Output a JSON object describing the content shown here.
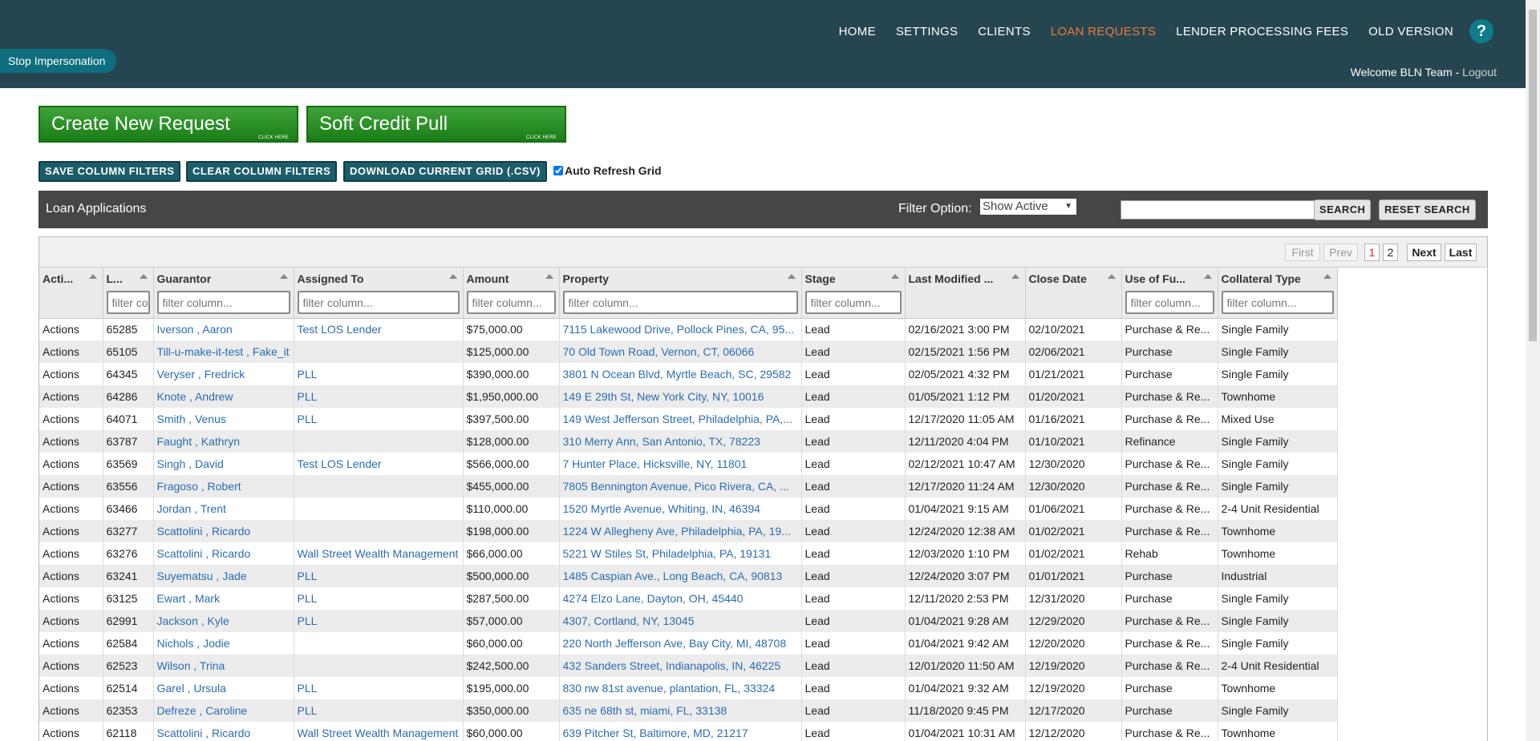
{
  "nav": {
    "items": [
      "HOME",
      "SETTINGS",
      "CLIENTS",
      "LOAN REQUESTS",
      "LENDER PROCESSING FEES",
      "OLD VERSION"
    ],
    "active": "LOAN REQUESTS",
    "help": "?"
  },
  "impersonation": {
    "label": "Stop Impersonation"
  },
  "welcome": {
    "text": "Welcome BLN Team",
    "separator": " - ",
    "logout": "Logout"
  },
  "actions": {
    "create_request": "Create New Request",
    "soft_credit": "Soft Credit Pull",
    "click_here": "CLICK HERE"
  },
  "toolbar": {
    "save_filters": "SAVE COLUMN FILTERS",
    "clear_filters": "CLEAR COLUMN FILTERS",
    "download_csv": "DOWNLOAD CURRENT GRID (.CSV)",
    "auto_refresh": "Auto Refresh Grid",
    "auto_refresh_checked": true
  },
  "panel": {
    "title": "Loan Applications",
    "filter_label": "Filter Option:",
    "filter_value": "Show Active",
    "search_value": "",
    "search_button": "SEARCH",
    "reset_button": "RESET SEARCH"
  },
  "pager": {
    "first": "First",
    "prev": "Prev",
    "pages": [
      "1",
      "2"
    ],
    "current": "1",
    "next": "Next",
    "last": "Last"
  },
  "filter_placeholder": "filter column...",
  "columns": [
    {
      "label": "Acti...",
      "filter": false
    },
    {
      "label": "L...",
      "filter": true
    },
    {
      "label": "Guarantor",
      "filter": true
    },
    {
      "label": "Assigned To",
      "filter": true
    },
    {
      "label": "Amount",
      "filter": true
    },
    {
      "label": "Property",
      "filter": true
    },
    {
      "label": "Stage",
      "filter": true
    },
    {
      "label": "Last Modified ...",
      "filter": false
    },
    {
      "label": "Close Date",
      "filter": false
    },
    {
      "label": "Use of Fu...",
      "filter": true
    },
    {
      "label": "Collateral Type",
      "filter": true
    }
  ],
  "rows": [
    [
      "Actions",
      "65285",
      "Iverson , Aaron",
      "Test LOS Lender",
      "$75,000.00",
      "7115 Lakewood Drive, Pollock Pines, CA, 95...",
      "Lead",
      "02/16/2021 3:00 PM",
      "02/10/2021",
      "Purchase & Re...",
      "Single Family"
    ],
    [
      "Actions",
      "65105",
      "Till-u-make-it-test , Fake_it",
      "",
      "$125,000.00",
      "70 Old Town Road, Vernon, CT, 06066",
      "Lead",
      "02/15/2021 1:56 PM",
      "02/06/2021",
      "Purchase",
      "Single Family"
    ],
    [
      "Actions",
      "64345",
      "Veryser , Fredrick",
      "PLL",
      "$390,000.00",
      "3801 N Ocean Blvd, Myrtle Beach, SC, 29582",
      "Lead",
      "02/05/2021 4:32 PM",
      "01/21/2021",
      "Purchase",
      "Single Family"
    ],
    [
      "Actions",
      "64286",
      "Knote , Andrew",
      "PLL",
      "$1,950,000.00",
      "149 E 29th St, New York City, NY, 10016",
      "Lead",
      "01/05/2021 1:12 PM",
      "01/20/2021",
      "Purchase & Re...",
      "Townhome"
    ],
    [
      "Actions",
      "64071",
      "Smith , Venus",
      "PLL",
      "$397,500.00",
      "149 West Jefferson Street, Philadelphia, PA,...",
      "Lead",
      "12/17/2020 11:05 AM",
      "01/16/2021",
      "Purchase & Re...",
      "Mixed Use"
    ],
    [
      "Actions",
      "63787",
      "Faught , Kathryn",
      "",
      "$128,000.00",
      "310 Merry Ann, San Antonio, TX, 78223",
      "Lead",
      "12/11/2020 4:04 PM",
      "01/10/2021",
      "Refinance",
      "Single Family"
    ],
    [
      "Actions",
      "63569",
      "Singh , David",
      "Test LOS Lender",
      "$566,000.00",
      "7 Hunter Place, Hicksville, NY, 11801",
      "Lead",
      "02/12/2021 10:47 AM",
      "12/30/2020",
      "Purchase & Re...",
      "Single Family"
    ],
    [
      "Actions",
      "63556",
      "Fragoso , Robert",
      "",
      "$455,000.00",
      "7805 Bennington Avenue, Pico Rivera, CA, ...",
      "Lead",
      "12/17/2020 11:24 AM",
      "12/30/2020",
      "Purchase & Re...",
      "Single Family"
    ],
    [
      "Actions",
      "63466",
      "Jordan , Trent",
      "",
      "$110,000.00",
      "1520 Myrtle Avenue, Whiting, IN, 46394",
      "Lead",
      "01/04/2021 9:15 AM",
      "01/06/2021",
      "Purchase & Re...",
      "2-4 Unit Residential"
    ],
    [
      "Actions",
      "63277",
      "Scattolini , Ricardo",
      "",
      "$198,000.00",
      "1224 W Allegheny Ave, Philadelphia, PA, 19...",
      "Lead",
      "12/24/2020 12:38 AM",
      "01/02/2021",
      "Purchase & Re...",
      "Townhome"
    ],
    [
      "Actions",
      "63276",
      "Scattolini , Ricardo",
      "Wall Street Wealth Management",
      "$66,000.00",
      "5221 W Stiles St, Philadelphia, PA, 19131",
      "Lead",
      "12/03/2020 1:10 PM",
      "01/02/2021",
      "Rehab",
      "Townhome"
    ],
    [
      "Actions",
      "63241",
      "Suyematsu , Jade",
      "PLL",
      "$500,000.00",
      "1485 Caspian Ave., Long Beach, CA, 90813",
      "Lead",
      "12/24/2020 3:07 PM",
      "01/01/2021",
      "Purchase",
      "Industrial"
    ],
    [
      "Actions",
      "63125",
      "Ewart , Mark",
      "PLL",
      "$287,500.00",
      "4274 Elzo Lane, Dayton, OH, 45440",
      "Lead",
      "12/11/2020 2:53 PM",
      "12/31/2020",
      "Purchase",
      "Single Family"
    ],
    [
      "Actions",
      "62991",
      "Jackson , Kyle",
      "PLL",
      "$57,000.00",
      "4307, Cortland, NY, 13045",
      "Lead",
      "01/04/2021 9:28 AM",
      "12/29/2020",
      "Purchase & Re...",
      "Single Family"
    ],
    [
      "Actions",
      "62584",
      "Nichols , Jodie",
      "",
      "$60,000.00",
      "220 North Jefferson Ave, Bay City, MI, 48708",
      "Lead",
      "01/04/2021 9:42 AM",
      "12/20/2020",
      "Purchase & Re...",
      "Single Family"
    ],
    [
      "Actions",
      "62523",
      "Wilson , Trina",
      "",
      "$242,500.00",
      "432 Sanders Street, Indianapolis, IN, 46225",
      "Lead",
      "12/01/2020 11:50 AM",
      "12/19/2020",
      "Purchase & Re...",
      "2-4 Unit Residential"
    ],
    [
      "Actions",
      "62514",
      "Garel , Ursula",
      "PLL",
      "$195,000.00",
      "830 nw 81st avenue, plantation, FL, 33324",
      "Lead",
      "01/04/2021 9:32 AM",
      "12/19/2020",
      "Purchase",
      "Townhome"
    ],
    [
      "Actions",
      "62353",
      "Defreze , Caroline",
      "PLL",
      "$350,000.00",
      "635 ne 68th st, miami, FL, 33138",
      "Lead",
      "11/18/2020 9:45 PM",
      "12/17/2020",
      "Purchase",
      "Single Family"
    ],
    [
      "Actions",
      "62118",
      "Scattolini , Ricardo",
      "Wall Street Wealth Management",
      "$60,000.00",
      "639 Pitcher St, Baltimore, MD, 21217",
      "Lead",
      "01/04/2021 10:31 AM",
      "12/12/2020",
      "Purchase & Re...",
      "Townhome"
    ]
  ]
}
